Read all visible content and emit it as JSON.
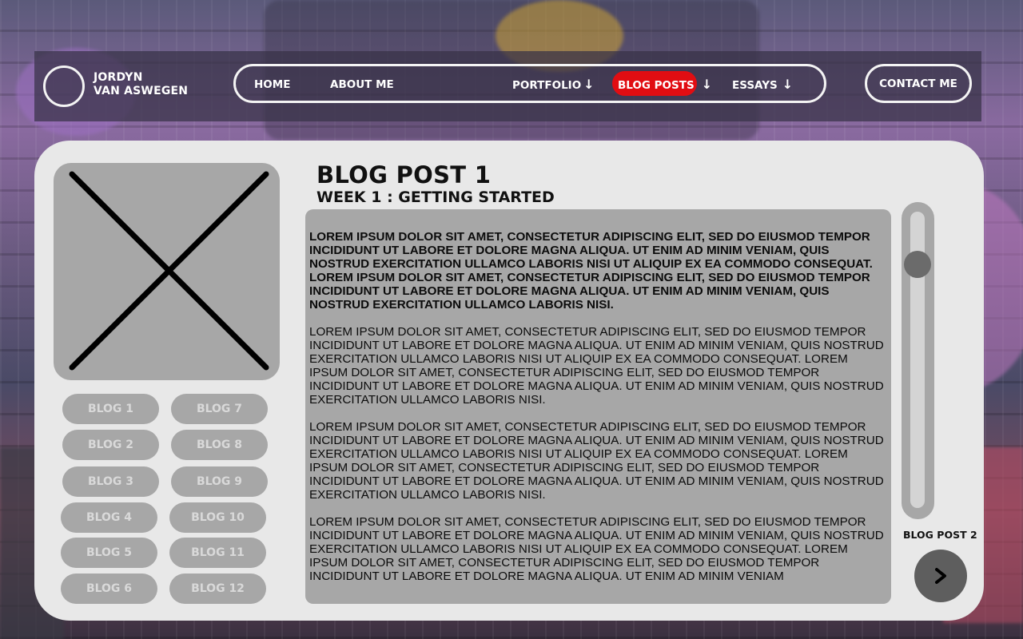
{
  "brand": {
    "first": "JORDYN",
    "last": "VAN ASWEGEN"
  },
  "nav": {
    "home": "HOME",
    "about": "ABOUT ME",
    "portfolio": "PORTFOLIO",
    "blog_posts": "BLOG POSTS",
    "essays": "ESSAYS",
    "dropdown_arrow": "↓",
    "contact": "CONTACT ME",
    "active_item": "BLOG POSTS",
    "active_color": "#e10d12"
  },
  "sidebar": {
    "image_placeholder_icon": "x-placeholder-icon",
    "blog_buttons": [
      "BLOG 1",
      "BLOG 2",
      "BLOG 3",
      "BLOG 4",
      "BLOG 5",
      "BLOG 6",
      "BLOG 7",
      "BLOG 8",
      "BLOG 9",
      "BLOG 10",
      "BLOG 11",
      "BLOG 12"
    ]
  },
  "post": {
    "title": "BLOG POST 1",
    "subtitle": "WEEK 1 : GETTING STARTED",
    "paragraphs": [
      "LOREM IPSUM DOLOR SIT AMET, CONSECTETUR ADIPISCING ELIT, SED DO EIUSMOD TEMPOR INCIDIDUNT UT LABORE ET DOLORE MAGNA ALIQUA. UT ENIM AD MINIM VENIAM, QUIS NOSTRUD EXERCITATION ULLAMCO LABORIS NISI UT ALIQUIP EX EA COMMODO CONSEQUAT. LOREM IPSUM DOLOR SIT AMET, CONSECTETUR ADIPISCING ELIT, SED DO EIUSMOD TEMPOR INCIDIDUNT UT LABORE ET DOLORE MAGNA ALIQUA. UT ENIM AD MINIM VENIAM, QUIS NOSTRUD EXERCITATION ULLAMCO LABORIS NISI.",
      "LOREM IPSUM DOLOR SIT AMET, CONSECTETUR ADIPISCING ELIT, SED DO EIUSMOD TEMPOR INCIDIDUNT UT LABORE ET DOLORE MAGNA ALIQUA. UT ENIM AD MINIM VENIAM, QUIS NOSTRUD EXERCITATION ULLAMCO LABORIS NISI UT ALIQUIP EX EA COMMODO CONSEQUAT. LOREM IPSUM DOLOR SIT AMET, CONSECTETUR ADIPISCING ELIT, SED DO EIUSMOD TEMPOR INCIDIDUNT UT LABORE ET DOLORE MAGNA ALIQUA. UT ENIM AD MINIM VENIAM, QUIS NOSTRUD EXERCITATION ULLAMCO LABORIS NISI.",
      "LOREM IPSUM DOLOR SIT AMET, CONSECTETUR ADIPISCING ELIT, SED DO EIUSMOD TEMPOR INCIDIDUNT UT LABORE ET DOLORE MAGNA ALIQUA. UT ENIM AD MINIM VENIAM, QUIS NOSTRUD EXERCITATION ULLAMCO LABORIS NISI UT ALIQUIP EX EA COMMODO CONSEQUAT. LOREM IPSUM DOLOR SIT AMET, CONSECTETUR ADIPISCING ELIT, SED DO EIUSMOD TEMPOR INCIDIDUNT UT LABORE ET DOLORE MAGNA ALIQUA. UT ENIM AD MINIM VENIAM, QUIS NOSTRUD EXERCITATION ULLAMCO LABORIS NISI.",
      "LOREM IPSUM DOLOR SIT AMET, CONSECTETUR ADIPISCING ELIT, SED DO EIUSMOD TEMPOR INCIDIDUNT UT LABORE ET DOLORE MAGNA ALIQUA. UT ENIM AD MINIM VENIAM, QUIS NOSTRUD EXERCITATION ULLAMCO LABORIS NISI UT ALIQUIP EX EA COMMODO CONSEQUAT. LOREM IPSUM DOLOR SIT AMET, CONSECTETUR ADIPISCING ELIT, SED DO EIUSMOD TEMPOR INCIDIDUNT UT LABORE ET DOLORE MAGNA ALIQUA. UT ENIM AD MINIM VENIAM"
    ]
  },
  "pager": {
    "next_label": "BLOG POST 2",
    "next_icon": "chevron-right-icon"
  },
  "colors": {
    "card_bg": "#e8e8e8",
    "panel_gray": "#a7a7a7",
    "button_text": "#d9d9d9"
  }
}
